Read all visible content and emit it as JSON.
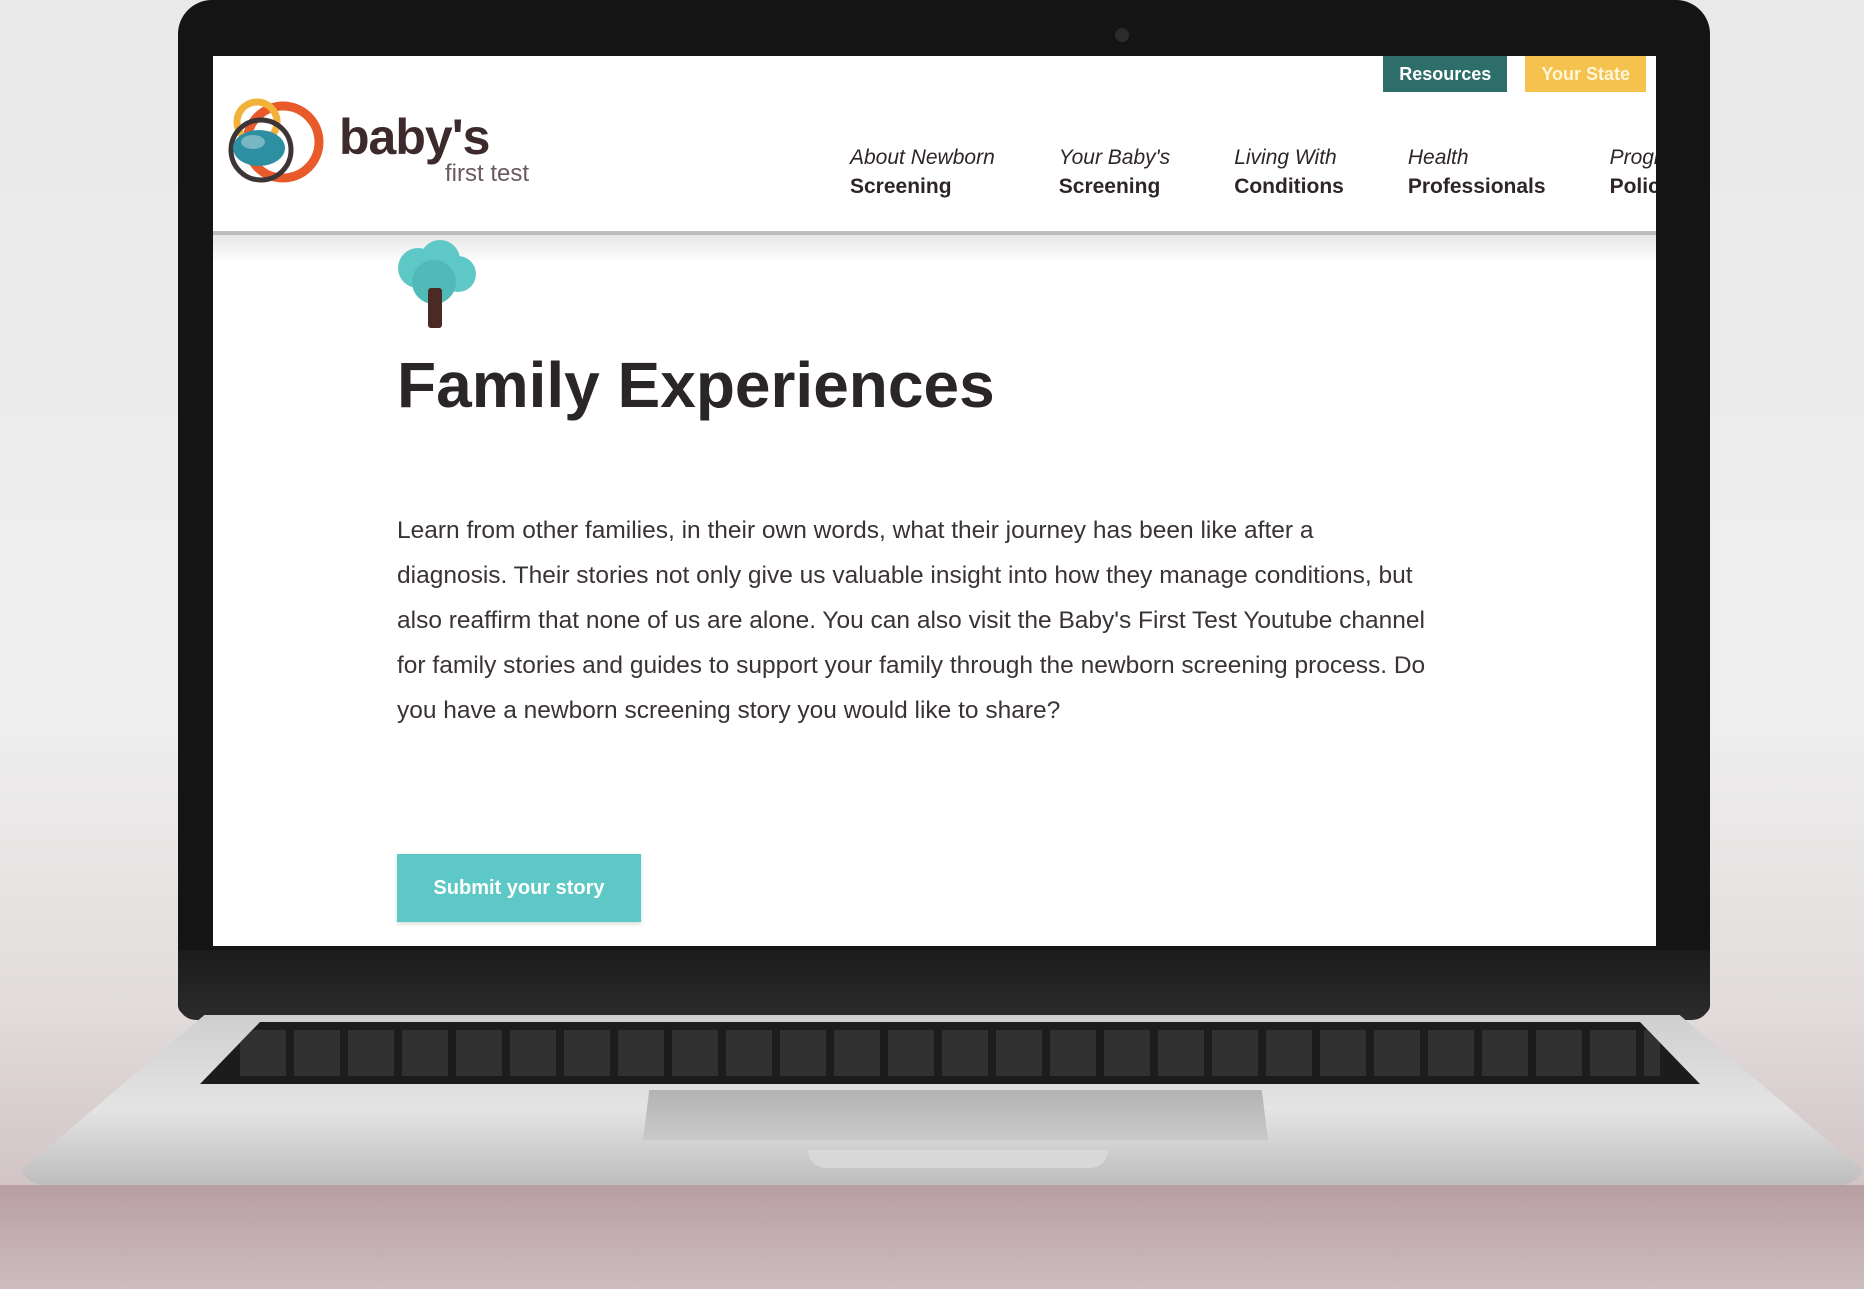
{
  "header": {
    "logo_text": "baby's",
    "logo_sub": "first test",
    "top_buttons": {
      "resources": "Resources",
      "your_state": "Your State"
    },
    "nav": [
      {
        "top": "About Newborn",
        "bottom": "Screening"
      },
      {
        "top": "Your Baby's",
        "bottom": "Screening"
      },
      {
        "top": "Living With",
        "bottom": "Conditions"
      },
      {
        "top": "Health",
        "bottom": "Professionals"
      },
      {
        "top": "Program",
        "bottom": "Policy"
      }
    ]
  },
  "main": {
    "title": "Family Experiences",
    "intro": "Learn from other families, in their own words, what their journey has been like after a diagnosis. Their stories not only give us valuable insight into how they manage conditions, but also reaffirm that none of us are alone. You can also visit the Baby's First Test Youtube channel for family stories and guides to support your family through the newborn screening process. Do you have a newborn screening story you would like to share?",
    "submit_label": "Submit your story"
  },
  "colors": {
    "teal_dark": "#2e6e6a",
    "yellow": "#f4c24d",
    "teal_button": "#5ec8c6",
    "text_dark": "#2a2526"
  }
}
